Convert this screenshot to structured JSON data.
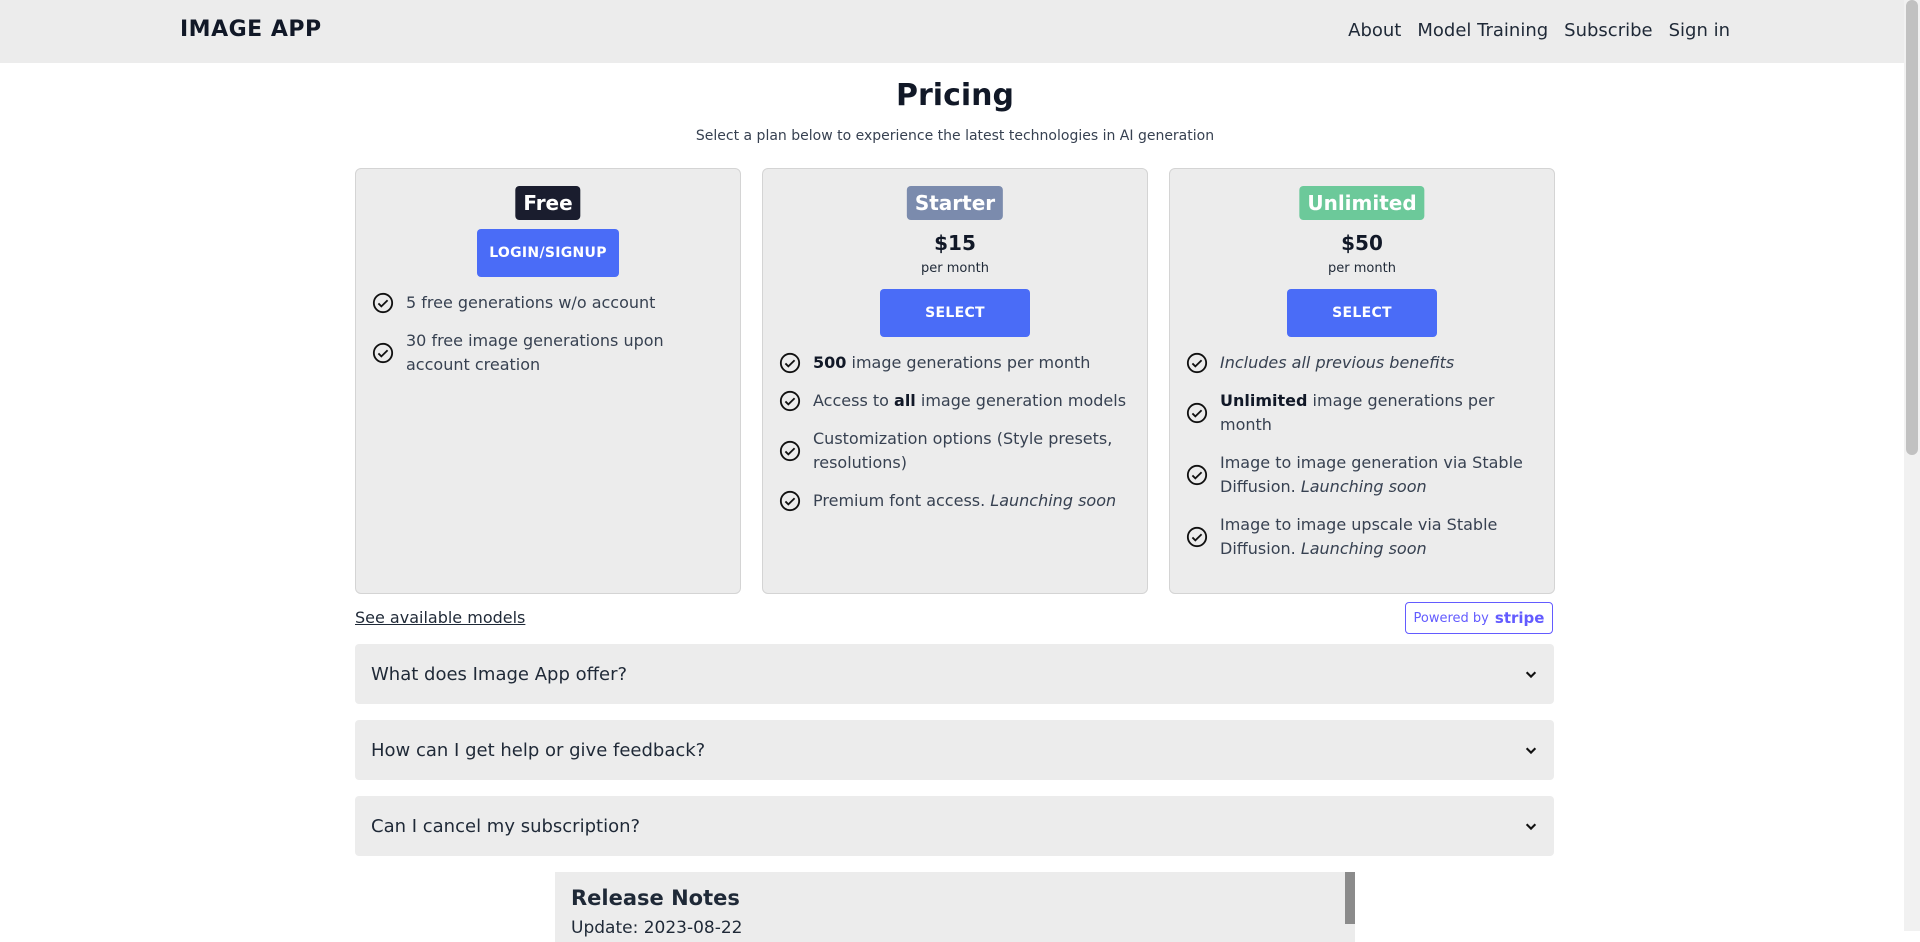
{
  "header": {
    "brand": "IMAGE APP",
    "nav": [
      "About",
      "Model Training",
      "Subscribe",
      "Sign in"
    ]
  },
  "page": {
    "title": "Pricing",
    "subtitle": "Select a plan below to experience the latest technologies in AI generation"
  },
  "plans": [
    {
      "badge": "Free",
      "badge_color": "#1a1d2e",
      "button": "LOGIN/SIGNUP",
      "features": [
        "5 free generations w/o account",
        "30 free image generations upon account creation"
      ]
    },
    {
      "badge": "Starter",
      "badge_color": "#7b8bad",
      "price": "$15",
      "period": "per month",
      "button": "SELECT",
      "features": [
        {
          "bold": "500",
          "text": " image generations per month"
        },
        {
          "pre": "Access to ",
          "bold": "all",
          "text": " image generation models"
        },
        {
          "text": "Customization options (Style presets, resolutions)"
        },
        {
          "text": "Premium font access. ",
          "italic": "Launching soon"
        }
      ]
    },
    {
      "badge": "Unlimited",
      "badge_color": "#6cc99a",
      "price": "$50",
      "period": "per month",
      "button": "SELECT",
      "features": [
        {
          "italic": "Includes all previous benefits"
        },
        {
          "bold": "Unlimited",
          "text": " image generations per month"
        },
        {
          "text": "Image to image generation via Stable Diffusion. ",
          "italic": "Launching soon"
        },
        {
          "text": "Image to image upscale via Stable Diffusion. ",
          "italic": "Launching soon"
        }
      ]
    }
  ],
  "links": {
    "models": "See available models",
    "stripe_prefix": "Powered by",
    "stripe_brand": "stripe"
  },
  "faq": [
    "What does Image App offer?",
    "How can I get help or give feedback?",
    "Can I cancel my subscription?"
  ],
  "release_notes": {
    "title": "Release Notes",
    "update": "Update: 2023-08-22"
  },
  "colors": {
    "accent": "#4a6cf7",
    "stripe": "#635bff"
  }
}
